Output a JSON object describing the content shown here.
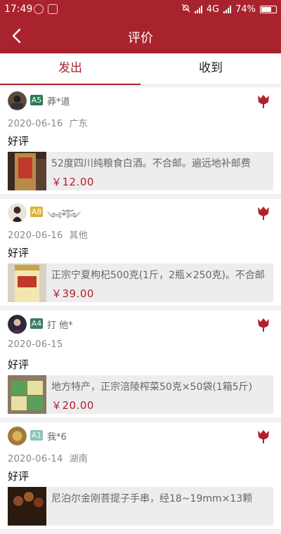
{
  "status": {
    "time": "17:49",
    "network": "4G",
    "battery": "74%",
    "battery_level": 0.74,
    "signal_icon": "signal-bars-icon"
  },
  "header": {
    "title": "评价",
    "back_icon": "back-arrow-icon"
  },
  "tabs": [
    {
      "label": "发出",
      "active": true
    },
    {
      "label": "收到",
      "active": false
    }
  ],
  "colors": {
    "brand": "#a8232d",
    "price": "#b3202b"
  },
  "reviews": [
    {
      "level": "A5",
      "level_color": "#2a7a55",
      "user": "莽*道",
      "date": "2020-06-16",
      "location": "广东",
      "rating": "好评",
      "product": "52度四川纯粮食白酒。不合邮。遍远地补邮费",
      "price": "￥12.00"
    },
    {
      "level": "A8",
      "level_color": "#e1b23a",
      "user": "༺ོ*ོ༻",
      "date": "2020-06-16",
      "location": "其他",
      "rating": "好评",
      "product": "正宗宁夏枸杞500克(1斤，2瓶×250克)。不合邮",
      "price": "￥39.00"
    },
    {
      "level": "A4",
      "level_color": "#3a7d63",
      "user": "打 他*",
      "date": "2020-06-15",
      "location": "",
      "rating": "好评",
      "product": "地方特产，正宗涪陵榨菜50克×50袋(1箱5斤)",
      "price": "￥20.00"
    },
    {
      "level": "A1",
      "level_color": "#8ac3b8",
      "user": "我*6",
      "date": "2020-06-14",
      "location": "湖南",
      "rating": "好评",
      "product": "尼泊尔金刚菩提子手串，经18~19mm×13颗",
      "price": ""
    }
  ]
}
